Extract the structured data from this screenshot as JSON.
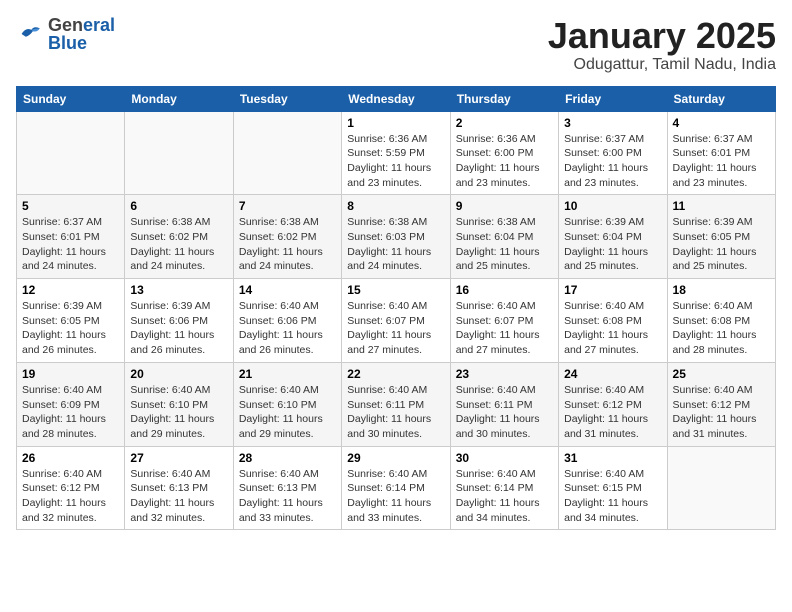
{
  "header": {
    "logo": {
      "general": "General",
      "blue": "Blue"
    },
    "title": "January 2025",
    "subtitle": "Odugattur, Tamil Nadu, India"
  },
  "weekdays": [
    "Sunday",
    "Monday",
    "Tuesday",
    "Wednesday",
    "Thursday",
    "Friday",
    "Saturday"
  ],
  "weeks": [
    [
      {
        "day": null,
        "info": null
      },
      {
        "day": null,
        "info": null
      },
      {
        "day": null,
        "info": null
      },
      {
        "day": "1",
        "info": "Sunrise: 6:36 AM\nSunset: 5:59 PM\nDaylight: 11 hours\nand 23 minutes."
      },
      {
        "day": "2",
        "info": "Sunrise: 6:36 AM\nSunset: 6:00 PM\nDaylight: 11 hours\nand 23 minutes."
      },
      {
        "day": "3",
        "info": "Sunrise: 6:37 AM\nSunset: 6:00 PM\nDaylight: 11 hours\nand 23 minutes."
      },
      {
        "day": "4",
        "info": "Sunrise: 6:37 AM\nSunset: 6:01 PM\nDaylight: 11 hours\nand 23 minutes."
      }
    ],
    [
      {
        "day": "5",
        "info": "Sunrise: 6:37 AM\nSunset: 6:01 PM\nDaylight: 11 hours\nand 24 minutes."
      },
      {
        "day": "6",
        "info": "Sunrise: 6:38 AM\nSunset: 6:02 PM\nDaylight: 11 hours\nand 24 minutes."
      },
      {
        "day": "7",
        "info": "Sunrise: 6:38 AM\nSunset: 6:02 PM\nDaylight: 11 hours\nand 24 minutes."
      },
      {
        "day": "8",
        "info": "Sunrise: 6:38 AM\nSunset: 6:03 PM\nDaylight: 11 hours\nand 24 minutes."
      },
      {
        "day": "9",
        "info": "Sunrise: 6:38 AM\nSunset: 6:04 PM\nDaylight: 11 hours\nand 25 minutes."
      },
      {
        "day": "10",
        "info": "Sunrise: 6:39 AM\nSunset: 6:04 PM\nDaylight: 11 hours\nand 25 minutes."
      },
      {
        "day": "11",
        "info": "Sunrise: 6:39 AM\nSunset: 6:05 PM\nDaylight: 11 hours\nand 25 minutes."
      }
    ],
    [
      {
        "day": "12",
        "info": "Sunrise: 6:39 AM\nSunset: 6:05 PM\nDaylight: 11 hours\nand 26 minutes."
      },
      {
        "day": "13",
        "info": "Sunrise: 6:39 AM\nSunset: 6:06 PM\nDaylight: 11 hours\nand 26 minutes."
      },
      {
        "day": "14",
        "info": "Sunrise: 6:40 AM\nSunset: 6:06 PM\nDaylight: 11 hours\nand 26 minutes."
      },
      {
        "day": "15",
        "info": "Sunrise: 6:40 AM\nSunset: 6:07 PM\nDaylight: 11 hours\nand 27 minutes."
      },
      {
        "day": "16",
        "info": "Sunrise: 6:40 AM\nSunset: 6:07 PM\nDaylight: 11 hours\nand 27 minutes."
      },
      {
        "day": "17",
        "info": "Sunrise: 6:40 AM\nSunset: 6:08 PM\nDaylight: 11 hours\nand 27 minutes."
      },
      {
        "day": "18",
        "info": "Sunrise: 6:40 AM\nSunset: 6:08 PM\nDaylight: 11 hours\nand 28 minutes."
      }
    ],
    [
      {
        "day": "19",
        "info": "Sunrise: 6:40 AM\nSunset: 6:09 PM\nDaylight: 11 hours\nand 28 minutes."
      },
      {
        "day": "20",
        "info": "Sunrise: 6:40 AM\nSunset: 6:10 PM\nDaylight: 11 hours\nand 29 minutes."
      },
      {
        "day": "21",
        "info": "Sunrise: 6:40 AM\nSunset: 6:10 PM\nDaylight: 11 hours\nand 29 minutes."
      },
      {
        "day": "22",
        "info": "Sunrise: 6:40 AM\nSunset: 6:11 PM\nDaylight: 11 hours\nand 30 minutes."
      },
      {
        "day": "23",
        "info": "Sunrise: 6:40 AM\nSunset: 6:11 PM\nDaylight: 11 hours\nand 30 minutes."
      },
      {
        "day": "24",
        "info": "Sunrise: 6:40 AM\nSunset: 6:12 PM\nDaylight: 11 hours\nand 31 minutes."
      },
      {
        "day": "25",
        "info": "Sunrise: 6:40 AM\nSunset: 6:12 PM\nDaylight: 11 hours\nand 31 minutes."
      }
    ],
    [
      {
        "day": "26",
        "info": "Sunrise: 6:40 AM\nSunset: 6:12 PM\nDaylight: 11 hours\nand 32 minutes."
      },
      {
        "day": "27",
        "info": "Sunrise: 6:40 AM\nSunset: 6:13 PM\nDaylight: 11 hours\nand 32 minutes."
      },
      {
        "day": "28",
        "info": "Sunrise: 6:40 AM\nSunset: 6:13 PM\nDaylight: 11 hours\nand 33 minutes."
      },
      {
        "day": "29",
        "info": "Sunrise: 6:40 AM\nSunset: 6:14 PM\nDaylight: 11 hours\nand 33 minutes."
      },
      {
        "day": "30",
        "info": "Sunrise: 6:40 AM\nSunset: 6:14 PM\nDaylight: 11 hours\nand 34 minutes."
      },
      {
        "day": "31",
        "info": "Sunrise: 6:40 AM\nSunset: 6:15 PM\nDaylight: 11 hours\nand 34 minutes."
      },
      {
        "day": null,
        "info": null
      }
    ]
  ]
}
